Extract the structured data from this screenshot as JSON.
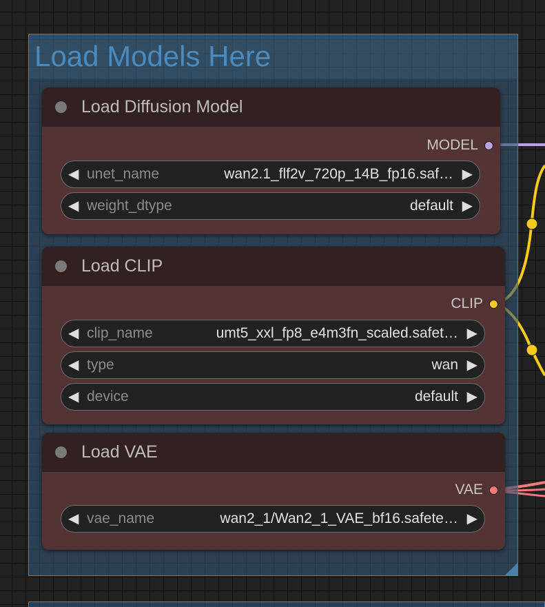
{
  "group": {
    "title": "Load Models Here"
  },
  "colors": {
    "model_link": "#b8a4e0",
    "clip_link": "#f5cc1d",
    "vae_link": "#ef7b7b"
  },
  "nodes": [
    {
      "title": "Load Diffusion Model",
      "output": {
        "label": "MODEL",
        "color": "#b8a4e0"
      },
      "widgets": [
        {
          "name": "unet_name",
          "value": "wan2.1_flf2v_720p_14B_fp16.saf…"
        },
        {
          "name": "weight_dtype",
          "value": "default"
        }
      ]
    },
    {
      "title": "Load CLIP",
      "output": {
        "label": "CLIP",
        "color": "#f5cc1d"
      },
      "widgets": [
        {
          "name": "clip_name",
          "value": "umt5_xxl_fp8_e4m3fn_scaled.safet…"
        },
        {
          "name": "type",
          "value": "wan"
        },
        {
          "name": "device",
          "value": "default"
        }
      ]
    },
    {
      "title": "Load VAE",
      "output": {
        "label": "VAE",
        "color": "#ef7b7b"
      },
      "widgets": [
        {
          "name": "vae_name",
          "value": "wan2_1/Wan2_1_VAE_bf16.safete…"
        }
      ]
    }
  ]
}
